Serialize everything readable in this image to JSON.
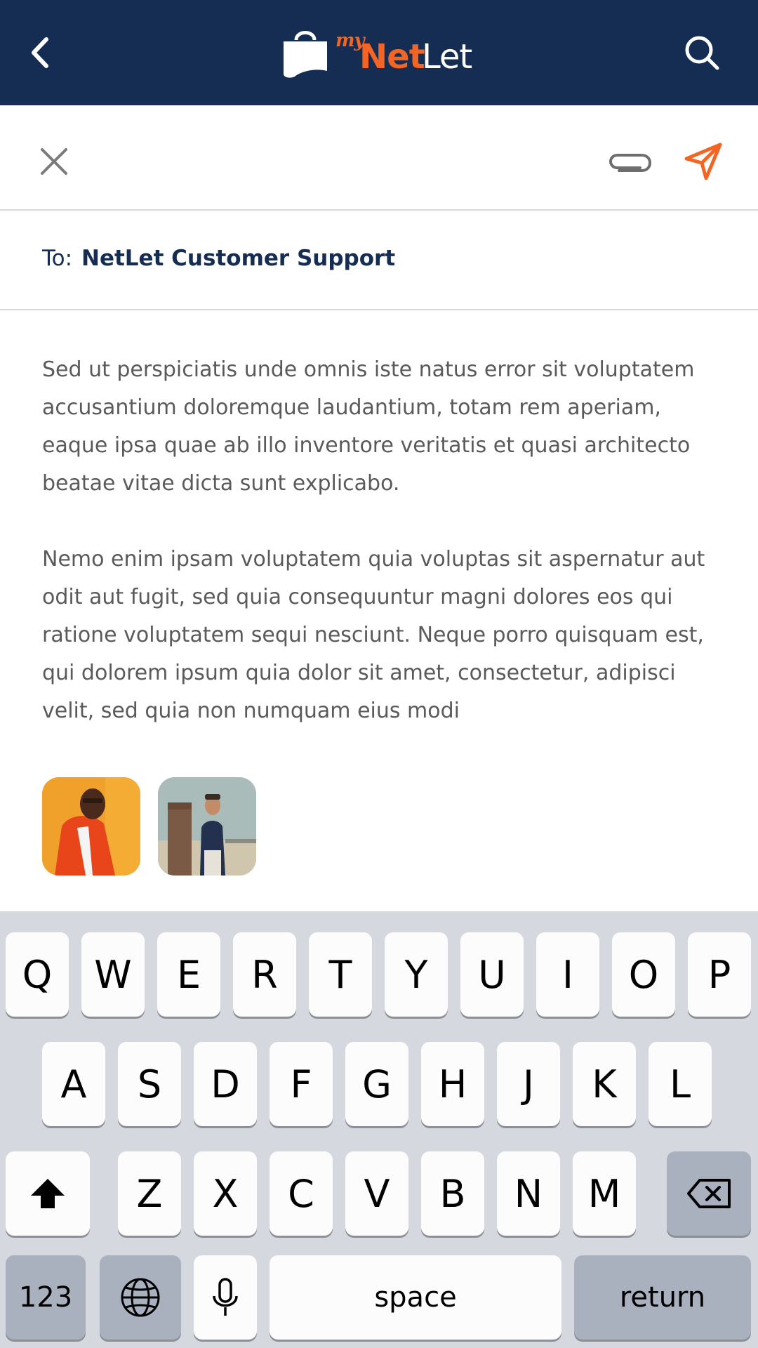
{
  "header": {
    "back_icon": "chevron-left-icon",
    "search_icon": "search-icon",
    "logo": {
      "my": "my",
      "net": "Net",
      "let": "Let"
    },
    "colors": {
      "background": "#152d52",
      "accent": "#f46524"
    }
  },
  "compose": {
    "close_icon": "close-icon",
    "attach_icon": "paperclip-icon",
    "send_icon": "send-icon",
    "to_label": "To:",
    "recipient": "NetLet Customer Support",
    "paragraphs": [
      "Sed ut perspiciatis unde omnis iste natus error sit voluptatem accusantium doloremque laudantium, totam rem aperiam, eaque ipsa quae ab illo inventore veritatis et quasi architecto beatae vitae dicta sunt explicabo.",
      "Nemo enim ipsam voluptatem quia voluptas sit aspernatur aut odit aut fugit, sed quia consequuntur magni dolores eos qui ratione voluptatem sequi nesciunt. Neque porro quisquam est, qui dolorem ipsum quia dolor sit amet, consectetur, adipisci velit, sed quia non numquam eius modi"
    ],
    "attachments": [
      "attachment-photo-orange",
      "attachment-photo-tower"
    ]
  },
  "keyboard": {
    "row1": [
      "Q",
      "W",
      "E",
      "R",
      "T",
      "Y",
      "U",
      "I",
      "O",
      "P"
    ],
    "row2": [
      "A",
      "S",
      "D",
      "F",
      "G",
      "H",
      "J",
      "K",
      "L"
    ],
    "row3": [
      "Z",
      "X",
      "C",
      "V",
      "B",
      "N",
      "M"
    ],
    "numbers_label": "123",
    "space_label": "space",
    "return_label": "return"
  }
}
